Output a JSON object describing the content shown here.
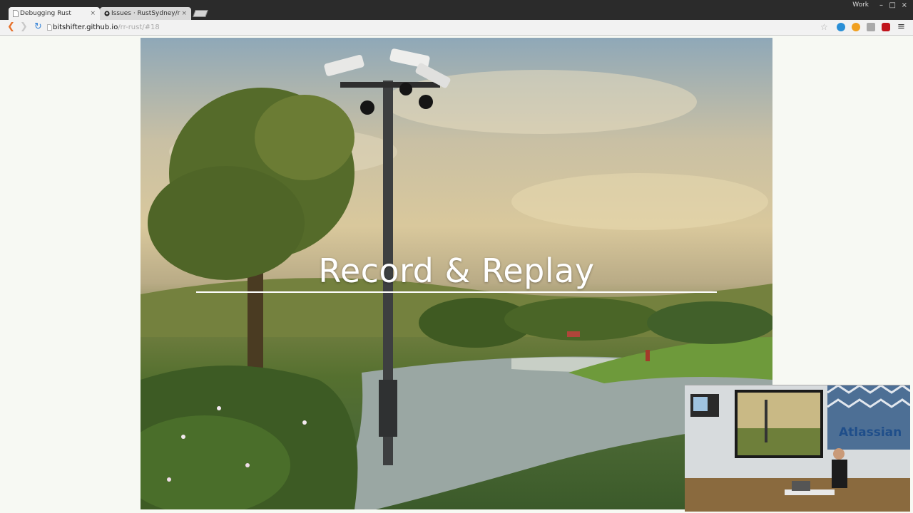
{
  "browser": {
    "tabs": [
      {
        "label": "Debugging Rust",
        "active": true
      },
      {
        "label": "Issues · RustSydney/r",
        "active": false
      }
    ],
    "profile_label": "Work",
    "url_host": "bitshifter.github.io",
    "url_path": "/rr-rust/#18"
  },
  "slide": {
    "title": "Record & Replay"
  },
  "webcam": {
    "sign_text": "Atlassian"
  },
  "colors": {
    "titlebar": "#2b2b2b",
    "toolbar": "#f2f2f2",
    "page_background": "#f7f9f3",
    "slide_title": "#ffffff"
  }
}
